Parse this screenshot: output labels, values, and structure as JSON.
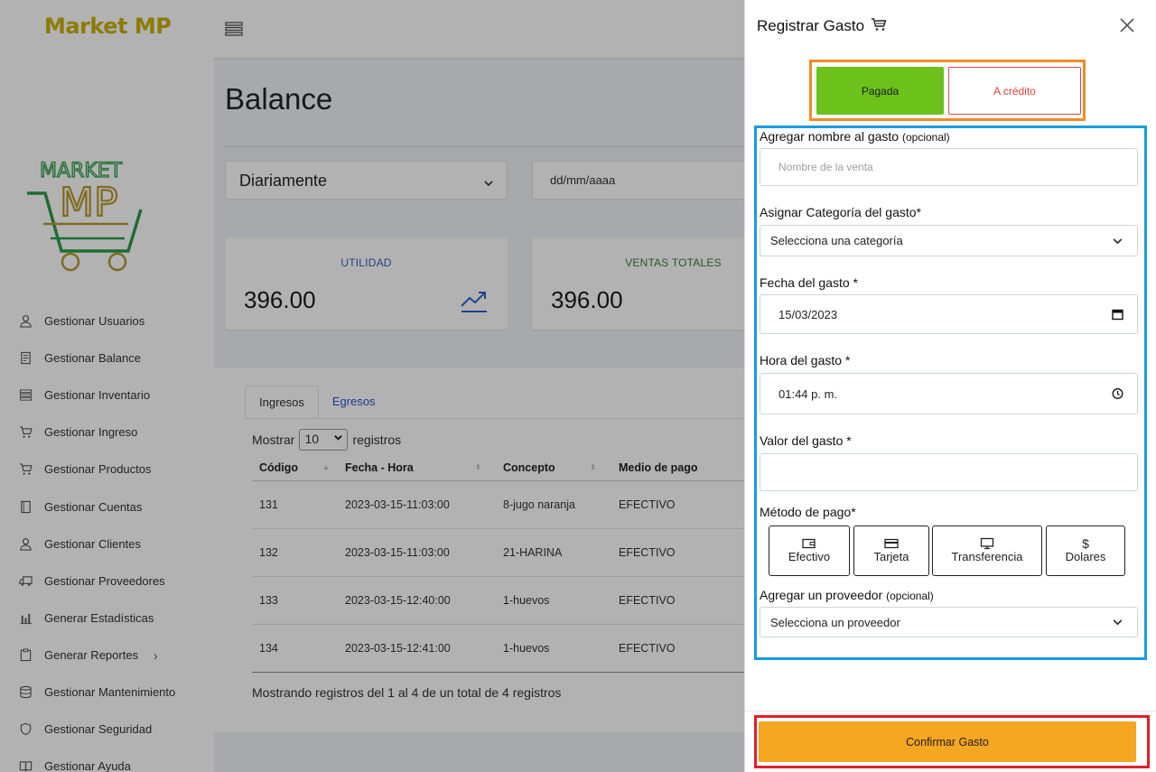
{
  "app": {
    "brand": "Market MP",
    "logo_text_top": "MARKET",
    "logo_text_bottom": "MP"
  },
  "sidebar": {
    "items": [
      {
        "label": "Gestionar Usuarios",
        "icon": "user-icon"
      },
      {
        "label": "Gestionar Balance",
        "icon": "ledger-icon"
      },
      {
        "label": "Gestionar Inventario",
        "icon": "inventory-icon"
      },
      {
        "label": "Gestionar Ingreso",
        "icon": "cart-icon"
      },
      {
        "label": "Gestionar Productos",
        "icon": "cart-icon"
      },
      {
        "label": "Gestionar Cuentas",
        "icon": "book-icon"
      },
      {
        "label": "Gestionar Clientes",
        "icon": "user-icon"
      },
      {
        "label": "Gestionar Proveedores",
        "icon": "truck-icon"
      },
      {
        "label": "Generar Estadísticas",
        "icon": "bar-chart-icon"
      },
      {
        "label": "Generar Reportes",
        "icon": "clipboard-icon"
      },
      {
        "label": "Gestionar Mantenimiento",
        "icon": "database-icon"
      },
      {
        "label": "Gestionar Seguridad",
        "icon": "shield-icon"
      },
      {
        "label": "Gestionar Ayuda",
        "icon": "open-book-icon"
      }
    ]
  },
  "main": {
    "title": "Balance",
    "period_select": "Diariamente",
    "date_placeholder": "dd/mm/aaaa",
    "cards": [
      {
        "label": "UTILIDAD",
        "value": "396.00",
        "label_color": "#2c62c9"
      },
      {
        "label": "VENTAS TOTALES",
        "value": "396.00",
        "label_color": "#3a7d3a"
      }
    ],
    "tabs": [
      "Ingresos",
      "Egresos"
    ],
    "show_prefix": "Mostrar",
    "show_value": "10",
    "show_suffix": "registros",
    "columns": [
      "Código",
      "Fecha - Hora",
      "Concepto",
      "Medio de pago"
    ],
    "rows": [
      [
        "131",
        "2023-03-15-11:03:00",
        "8-jugo naranja",
        "EFECTIVO"
      ],
      [
        "132",
        "2023-03-15-11:03:00",
        "21-HARINA",
        "EFECTIVO"
      ],
      [
        "133",
        "2023-03-15-12:40:00",
        "1-huevos",
        "EFECTIVO"
      ],
      [
        "134",
        "2023-03-15-12:41:00",
        "1-huevos",
        "EFECTIVO"
      ]
    ],
    "footer": "Mostrando registros del 1 al 4 de un total de 4 registros"
  },
  "offcanvas": {
    "title": "Registrar Gasto",
    "status_paid": "Pagada",
    "status_credit": "A crédito",
    "name_label": "Agregar nombre al gasto",
    "name_optional": "(opcional)",
    "name_placeholder": "Nombre de la venta",
    "category_label": "Asignar Categoría del gasto*",
    "category_value": "Selecciona una categoría",
    "date_label": "Fecha del gasto *",
    "date_value": "15/03/2023",
    "time_label": "Hora del gasto *",
    "time_value": "01:44 p. m.",
    "amount_label": "Valor del gasto *",
    "amount_value": "",
    "payment_label": "Método de pago*",
    "payment_methods": [
      {
        "label": "Efectivo",
        "icon": "wallet-icon"
      },
      {
        "label": "Tarjeta",
        "icon": "credit-card-icon"
      },
      {
        "label": "Transferencia",
        "icon": "monitor-icon"
      },
      {
        "label": "Dolares",
        "icon": "dollar-icon"
      }
    ],
    "supplier_label": "Agregar un proveedor",
    "supplier_optional": "(opcional)",
    "supplier_value": "Selecciona un proveedor",
    "confirm_label": "Confirmar Gasto"
  },
  "colors": {
    "paid_green": "#6cc11b",
    "credit_red": "#e03c3c",
    "confirm_orange": "#f5a623",
    "brand_gold": "#c9b100",
    "highlight_orange": "#f08a2a",
    "highlight_blue": "#189be0",
    "highlight_red": "#e0202a"
  }
}
